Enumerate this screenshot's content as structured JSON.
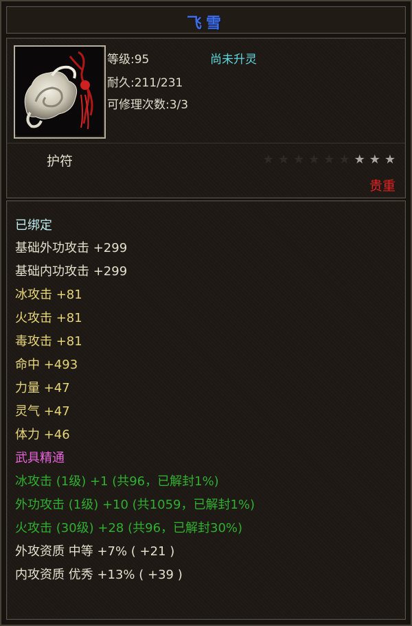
{
  "item": {
    "name": "飞雪",
    "level_label": "等级:95",
    "spirit_status": "尚未升灵",
    "durability_label": "耐久:211/231",
    "repair_label": "可修理次数:3/3",
    "type": "护符",
    "rarity": "贵重",
    "stars": {
      "total": 9,
      "lit": 3
    },
    "icon": "jade-amulet-icon"
  },
  "stats": {
    "bound": "已绑定",
    "base": [
      "基础外功攻击 +299",
      "基础内功攻击 +299"
    ],
    "elemental": [
      "冰攻击 +81",
      "火攻击 +81",
      "毒攻击 +81",
      "命中 +493",
      "力量 +47",
      "灵气 +47",
      "体力 +46"
    ],
    "mastery_header": "武具精通",
    "mastery": [
      "冰攻击 (1级) +1 (共96，已解封1%)",
      "外功攻击 (1级) +10 (共1059，已解封1%)",
      "火攻击 (30级) +28 (共96，已解封30%)"
    ],
    "aptitude": [
      "外攻资质  中等 +7% ( +21 )",
      "内攻资质  优秀 +13% ( +39 )"
    ]
  },
  "colors": {
    "title": "#3c6ee8",
    "rarity": "#e62020",
    "mastery": "#30b030",
    "mastery_header": "#ea64dc",
    "spirit_status": "#5fd8e0"
  }
}
